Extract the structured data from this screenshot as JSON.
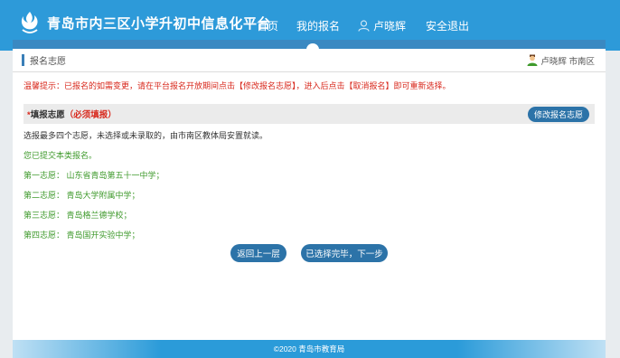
{
  "header": {
    "site_title": "青岛市内三区小学升初中信息化平台",
    "nav": {
      "home": "首页",
      "my_signup": "我的报名",
      "user_name": "卢晓辉",
      "logout": "安全退出"
    },
    "brand_color": "#2d9ad9"
  },
  "breadcrumb": {
    "label": "报名志愿",
    "user": "卢晓辉 市南区"
  },
  "tip": "温馨提示：已报名的如需变更，请在平台报名开放期间点击【修改报名志愿】，进入后点击【取消报名】即可重新选择。",
  "section": {
    "star": "*",
    "title": "填报志愿",
    "required": "（必须填报）",
    "modify_button": "修改报名志愿"
  },
  "note": "选报最多四个志愿，未选择或未录取的，由市南区教体局安置就读。",
  "submitted": "您已提交本类报名。",
  "choices": [
    "第一志愿：  山东省青岛第五十一中学；",
    "第二志愿：  青岛大学附属中学；",
    "第三志愿：  青岛格兰德学校；",
    "第四志愿：  青岛国开实验中学；"
  ],
  "buttons": {
    "back": "返回上一层",
    "next": "已选择完毕，下一步"
  },
  "footer": "©2020 青岛市教育局"
}
